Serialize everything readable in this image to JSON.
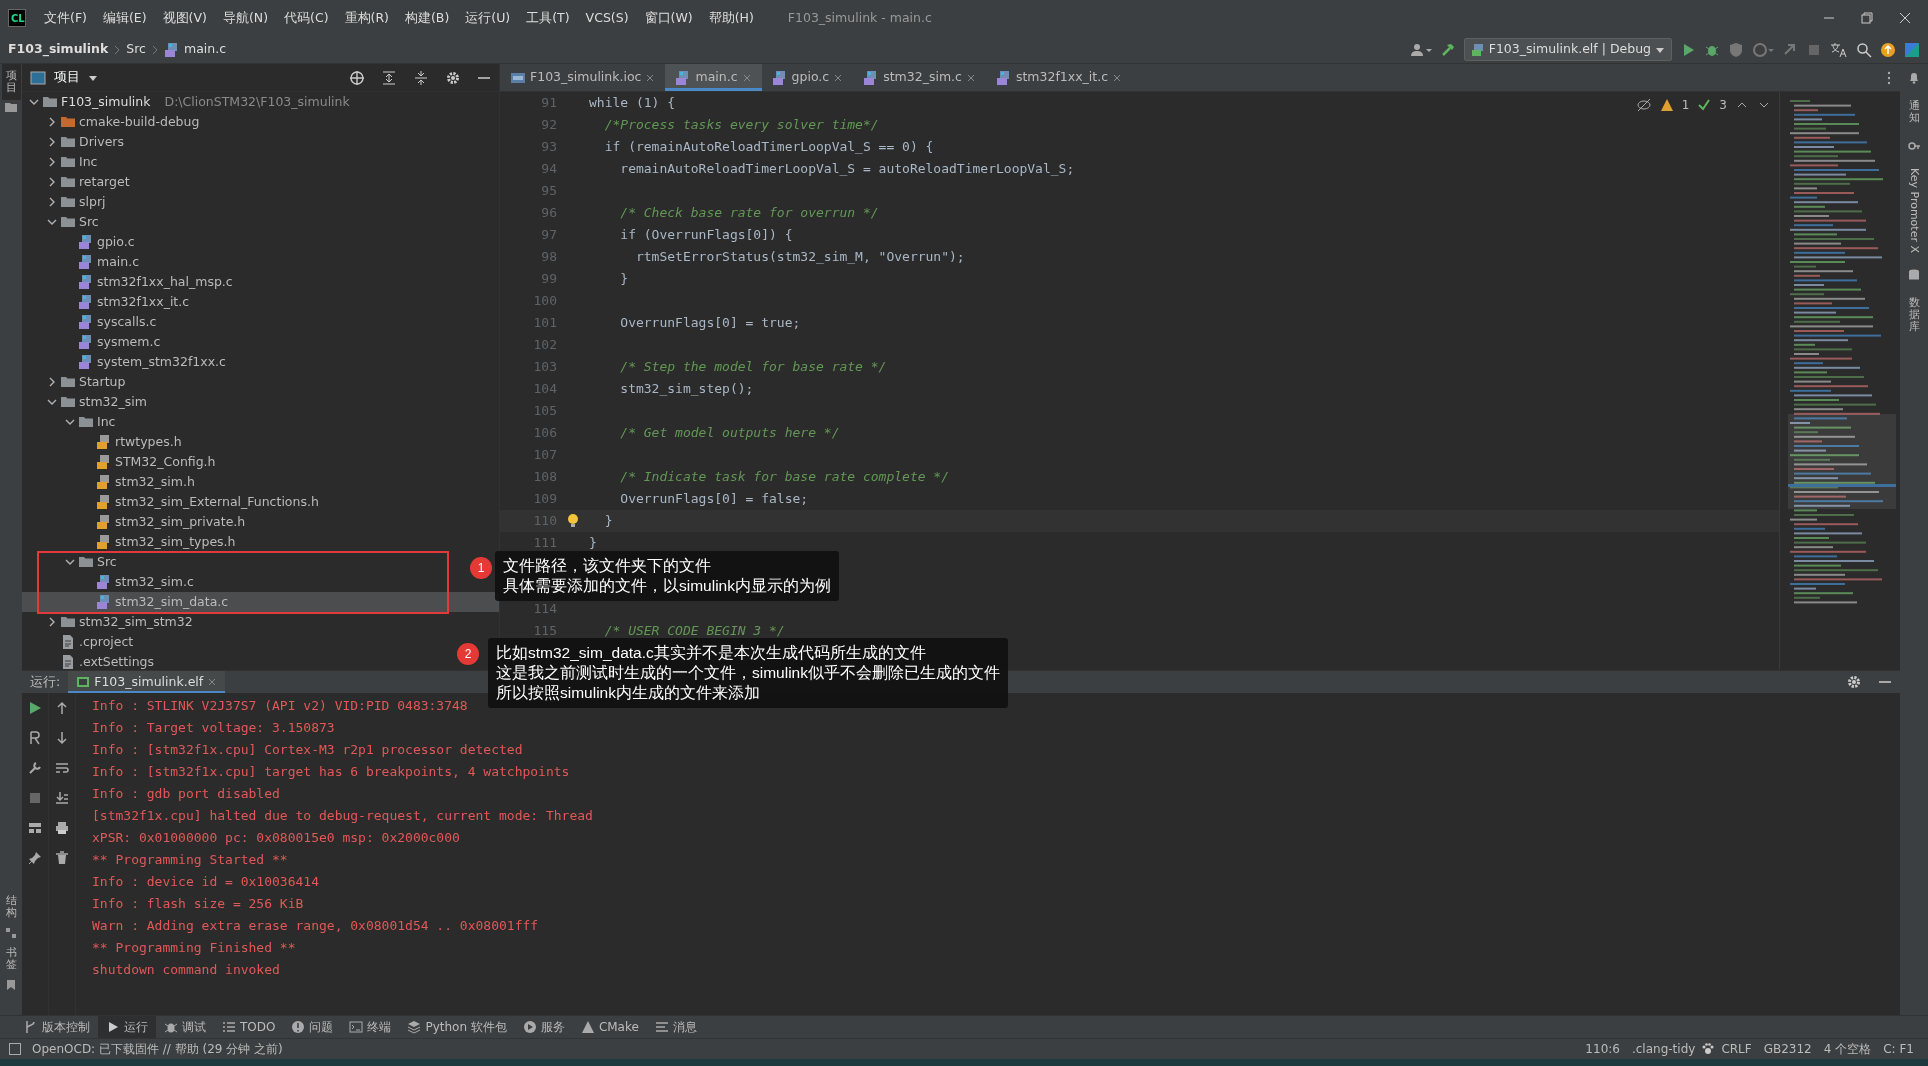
{
  "window": {
    "logo": "CL",
    "title": "F103_simulink - main.c"
  },
  "menu": [
    "文件(F)",
    "编辑(E)",
    "视图(V)",
    "导航(N)",
    "代码(C)",
    "重构(R)",
    "构建(B)",
    "运行(U)",
    "工具(T)",
    "VCS(S)",
    "窗口(W)",
    "帮助(H)"
  ],
  "breadcrumb": [
    {
      "label": "F103_simulink",
      "kind": "project"
    },
    {
      "label": "Src",
      "kind": "folder"
    },
    {
      "label": "main.c",
      "kind": "c"
    }
  ],
  "run_config": "F103_simulink.elf | Debug",
  "left_strip": {
    "top": [
      {
        "label": "项目",
        "selected": true
      }
    ],
    "bottom": [
      {
        "label": "结构"
      },
      {
        "label": "书签"
      }
    ]
  },
  "right_strip": [
    {
      "label": "通知",
      "kind": "bell"
    },
    {
      "label": "Key Promoter X",
      "kind": "key"
    },
    {
      "label": "数据库",
      "kind": "database"
    }
  ],
  "project_panel": {
    "title": "项目",
    "tree": [
      {
        "label": "F103_simulink",
        "path": "D:\\ClionSTM32\\F103_simulink",
        "kind": "folder",
        "expanded": true,
        "selected": false,
        "children": [
          {
            "label": "cmake-build-debug",
            "kind": "build",
            "expanded": false,
            "selected": false
          },
          {
            "label": "Drivers",
            "kind": "folder",
            "expanded": false,
            "selected": false
          },
          {
            "label": "Inc",
            "kind": "folder",
            "expanded": false,
            "selected": false
          },
          {
            "label": "retarget",
            "kind": "folder",
            "expanded": false,
            "selected": false
          },
          {
            "label": "slprj",
            "kind": "folder",
            "expanded": false,
            "selected": false
          },
          {
            "label": "Src",
            "kind": "folder",
            "expanded": true,
            "selected": false,
            "children": [
              {
                "label": "gpio.c",
                "kind": "c",
                "selected": false
              },
              {
                "label": "main.c",
                "kind": "c",
                "selected": false
              },
              {
                "label": "stm32f1xx_hal_msp.c",
                "kind": "c",
                "selected": false
              },
              {
                "label": "stm32f1xx_it.c",
                "kind": "c",
                "selected": false
              },
              {
                "label": "syscalls.c",
                "kind": "c",
                "selected": false
              },
              {
                "label": "sysmem.c",
                "kind": "c",
                "selected": false
              },
              {
                "label": "system_stm32f1xx.c",
                "kind": "c",
                "selected": false
              }
            ]
          },
          {
            "label": "Startup",
            "kind": "folder",
            "expanded": false,
            "selected": false
          },
          {
            "label": "stm32_sim",
            "kind": "folder",
            "expanded": true,
            "selected": false,
            "children": [
              {
                "label": "Inc",
                "kind": "folder",
                "expanded": true,
                "selected": false,
                "children": [
                  {
                    "label": "rtwtypes.h",
                    "kind": "h",
                    "selected": false
                  },
                  {
                    "label": "STM32_Config.h",
                    "kind": "h",
                    "selected": false
                  },
                  {
                    "label": "stm32_sim.h",
                    "kind": "h",
                    "selected": false
                  },
                  {
                    "label": "stm32_sim_External_Functions.h",
                    "kind": "h",
                    "selected": false
                  },
                  {
                    "label": "stm32_sim_private.h",
                    "kind": "h",
                    "selected": false
                  },
                  {
                    "label": "stm32_sim_types.h",
                    "kind": "h",
                    "selected": false
                  }
                ]
              },
              {
                "label": "Src",
                "kind": "folder",
                "expanded": true,
                "selected": false,
                "children": [
                  {
                    "label": "stm32_sim.c",
                    "kind": "c",
                    "selected": false
                  },
                  {
                    "label": "stm32_sim_data.c",
                    "kind": "c",
                    "selected": true
                  }
                ]
              }
            ]
          },
          {
            "label": "stm32_sim_stm32",
            "kind": "folder",
            "expanded": false,
            "selected": false
          },
          {
            "label": ".cproject",
            "kind": "file",
            "selected": false
          },
          {
            "label": ".extSettings",
            "kind": "file",
            "selected": false
          }
        ]
      }
    ]
  },
  "editor": {
    "tabs": [
      {
        "label": "F103_simulink.ioc",
        "kind": "ioc",
        "selected": false
      },
      {
        "label": "main.c",
        "kind": "c",
        "selected": true
      },
      {
        "label": "gpio.c",
        "kind": "c",
        "selected": false
      },
      {
        "label": "stm32_sim.c",
        "kind": "c",
        "selected": false
      },
      {
        "label": "stm32f1xx_it.c",
        "kind": "c",
        "selected": false
      }
    ],
    "warnings": "1",
    "checks": "3",
    "lines": [
      {
        "number": "91",
        "text": "while (1) {",
        "kind": "code",
        "current": false
      },
      {
        "number": "92",
        "text": "  /*Process tasks every solver time*/",
        "kind": "comment",
        "current": false
      },
      {
        "number": "93",
        "text": "  if (remainAutoReloadTimerLoopVal_S == 0) {",
        "kind": "code",
        "current": false
      },
      {
        "number": "94",
        "text": "    remainAutoReloadTimerLoopVal_S = autoReloadTimerLoopVal_S;",
        "kind": "code",
        "current": false
      },
      {
        "number": "95",
        "kind": "code",
        "current": false
      },
      {
        "number": "96",
        "text": "    /* Check base rate for overrun */",
        "kind": "comment",
        "current": false
      },
      {
        "number": "97",
        "text": "    if (OverrunFlags[0]) {",
        "kind": "code",
        "current": false
      },
      {
        "number": "98",
        "text": "      rtmSetErrorStatus(stm32_sim_M, \"Overrun\");",
        "kind": "code",
        "current": false
      },
      {
        "number": "99",
        "text": "    }",
        "kind": "code",
        "current": false
      },
      {
        "number": "100",
        "kind": "code",
        "current": false
      },
      {
        "number": "101",
        "text": "    OverrunFlags[0] = true;",
        "kind": "code",
        "current": false
      },
      {
        "number": "102",
        "kind": "code",
        "current": false
      },
      {
        "number": "103",
        "text": "    /* Step the model for base rate */",
        "kind": "comment",
        "current": false
      },
      {
        "number": "104",
        "text": "    stm32_sim_step();",
        "kind": "code",
        "current": false
      },
      {
        "number": "105",
        "kind": "code",
        "current": false
      },
      {
        "number": "106",
        "text": "    /* Get model outputs here */",
        "kind": "comment",
        "current": false
      },
      {
        "number": "107",
        "kind": "code",
        "current": false
      },
      {
        "number": "108",
        "text": "    /* Indicate task for base rate complete */",
        "kind": "comment",
        "current": false
      },
      {
        "number": "109",
        "text": "    OverrunFlags[0] = false;",
        "kind": "code",
        "current": false
      },
      {
        "number": "110",
        "text": "  }",
        "kind": "code",
        "current": true
      },
      {
        "number": "111",
        "text": "}",
        "kind": "code",
        "current": false
      },
      {
        "kind": "hidden"
      },
      {
        "kind": "hidden"
      },
      {
        "number": "114",
        "kind": "code",
        "current": false
      },
      {
        "number": "115",
        "text": "  /* USER CODE BEGIN 3 */",
        "kind": "comment",
        "current": false
      }
    ]
  },
  "run_panel": {
    "label": "运行:",
    "tab": "F103_simulink.elf",
    "console": [
      "Info : STLINK V2J37S7 (API v2) VID:PID 0483:3748",
      "Info : Target voltage: 3.150873",
      "Info : [stm32f1x.cpu] Cortex-M3 r2p1 processor detected",
      "Info : [stm32f1x.cpu] target has 6 breakpoints, 4 watchpoints",
      "Info : gdb port disabled",
      "[stm32f1x.cpu] halted due to debug-request, current mode: Thread",
      "xPSR: 0x01000000 pc: 0x080015e0 msp: 0x2000c000",
      "** Programming Started **",
      "Info : device id = 0x10036414",
      "Info : flash size = 256 KiB",
      "Warn : Adding extra erase range, 0x08001d54 .. 0x08001fff",
      "** Programming Finished **",
      "shutdown command invoked"
    ]
  },
  "tool_tabs": [
    {
      "label": "版本控制",
      "kind": "vcs",
      "selected": false
    },
    {
      "label": "运行",
      "kind": "run",
      "selected": true
    },
    {
      "label": "调试",
      "kind": "debug",
      "selected": false
    },
    {
      "label": "TODO",
      "kind": "todo",
      "selected": false
    },
    {
      "label": "问题",
      "kind": "problems",
      "selected": false
    },
    {
      "label": "终端",
      "kind": "terminal",
      "selected": false
    },
    {
      "label": "Python 软件包",
      "kind": "python",
      "selected": false
    },
    {
      "label": "服务",
      "kind": "services",
      "selected": false
    },
    {
      "label": "CMake",
      "kind": "cmake",
      "selected": false
    },
    {
      "label": "消息",
      "kind": "messages",
      "selected": false
    }
  ],
  "status_bar": {
    "message": "OpenOCD: 已下载固件 // 帮助 (29 分钟 之前)",
    "items": [
      "110:6",
      ".clang-tidy",
      "CRLF",
      "GB2312",
      "4 个空格",
      "C: F1"
    ]
  },
  "callouts": [
    {
      "number": "1",
      "lines": [
        "文件路径，该文件夹下的文件",
        "具体需要添加的文件，以simulink内显示的为例"
      ]
    },
    {
      "number": "2",
      "lines": [
        "比如stm32_sim_data.c其实并不是本次生成代码所生成的文件",
        "这是我之前测试时生成的一个文件，simulink似乎不会删除已生成的文件",
        "所以按照simulink内生成的文件来添加"
      ]
    }
  ]
}
